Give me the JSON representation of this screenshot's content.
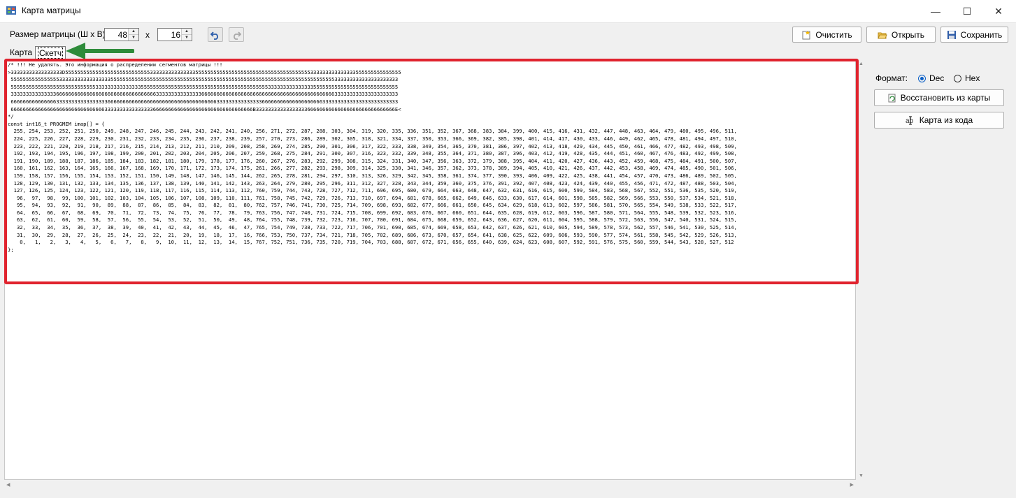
{
  "window": {
    "title": "Карта матрицы",
    "minimize": "—",
    "maximize": "☐",
    "close": "✕"
  },
  "toolbar": {
    "size_label": "Размер матрицы (Ш x В)",
    "width_value": "48",
    "height_value": "16",
    "x_label": "x",
    "undo_icon": "undo-icon",
    "redo_icon": "redo-icon",
    "clear_label": "Очистить",
    "open_label": "Открыть",
    "save_label": "Сохранить"
  },
  "tabs": [
    {
      "label": "Карта",
      "active": false
    },
    {
      "label": "Скетч",
      "active": true
    }
  ],
  "editor": {
    "lines": [
      "/* !!! Не удалять. Это информация о распределении сегментов матрицы !!!",
      ">33333333333333333D555555555555555555555555555533333333333333355555555555555555555555555555555555555333333333333333555555555555555",
      " 55555555555555553333333333333333355555555555555555555555555555555555555555555555555555555555555555555555555333333333333333333333",
      " 55555555555555555555555555553333333333333335555555555555555555555555555555555555555553333333333333335555555555555555555555555555",
      " 33333333333333366666666666666666666666666666666633333333333333366666666666666666666666666666666666666666666333333333333333333333",
      " 66666666666666633333333333333333666666666666666666666666666666666666333333333333333666666666666666666663333333333333333333333333",
      " 66666666666666666666666666666663333333333333333666666666666666666666666666666666B3333333333333333366666666666666666666666666666E<",
      "*/",
      "const int16_t PROGMEM imap[] = {",
      "  255, 254, 253, 252, 251, 250, 249, 248, 247, 246, 245, 244, 243, 242, 241, 240, 256, 271, 272, 287, 288, 303, 304, 319, 320, 335, 336, 351, 352, 367, 368, 383, 384, 399, 400, 415, 416, 431, 432, 447, 448, 463, 464, 479, 480, 495, 496, 511,",
      "  224, 225, 226, 227, 228, 229, 230, 231, 232, 233, 234, 235, 236, 237, 238, 239, 257, 270, 273, 286, 289, 302, 305, 318, 321, 334, 337, 350, 353, 366, 369, 382, 385, 398, 401, 414, 417, 430, 433, 446, 449, 462, 465, 478, 481, 494, 497, 510,",
      "  223, 222, 221, 220, 219, 218, 217, 216, 215, 214, 213, 212, 211, 210, 209, 208, 258, 269, 274, 285, 290, 301, 306, 317, 322, 333, 338, 349, 354, 365, 370, 381, 386, 397, 402, 413, 418, 429, 434, 445, 450, 461, 466, 477, 482, 493, 498, 509,",
      "  192, 193, 194, 195, 196, 197, 198, 199, 200, 201, 202, 203, 204, 205, 206, 207, 259, 268, 275, 284, 291, 300, 307, 316, 323, 332, 339, 348, 355, 364, 371, 380, 387, 396, 403, 412, 419, 428, 435, 444, 451, 460, 467, 476, 483, 492, 499, 508,",
      "  191, 190, 189, 188, 187, 186, 185, 184, 183, 182, 181, 180, 179, 178, 177, 176, 260, 267, 276, 283, 292, 299, 308, 315, 324, 331, 340, 347, 356, 363, 372, 379, 388, 395, 404, 411, 420, 427, 436, 443, 452, 459, 468, 475, 484, 491, 500, 507,",
      "  160, 161, 162, 163, 164, 165, 166, 167, 168, 169, 170, 171, 172, 173, 174, 175, 261, 266, 277, 282, 293, 298, 309, 314, 325, 330, 341, 346, 357, 362, 373, 378, 389, 394, 405, 410, 421, 426, 437, 442, 453, 458, 469, 474, 485, 490, 501, 506,",
      "  159, 158, 157, 156, 155, 154, 153, 152, 151, 150, 149, 148, 147, 146, 145, 144, 262, 265, 278, 281, 294, 297, 310, 313, 326, 329, 342, 345, 358, 361, 374, 377, 390, 393, 406, 409, 422, 425, 438, 441, 454, 457, 470, 473, 486, 489, 502, 505,",
      "  128, 129, 130, 131, 132, 133, 134, 135, 136, 137, 138, 139, 140, 141, 142, 143, 263, 264, 279, 280, 295, 296, 311, 312, 327, 328, 343, 344, 359, 360, 375, 376, 391, 392, 407, 408, 423, 424, 439, 440, 455, 456, 471, 472, 487, 488, 503, 504,",
      "  127, 126, 125, 124, 123, 122, 121, 120, 119, 118, 117, 116, 115, 114, 113, 112, 760, 759, 744, 743, 728, 727, 712, 711, 696, 695, 680, 679, 664, 663, 648, 647, 632, 631, 616, 615, 600, 599, 584, 583, 568, 567, 552, 551, 536, 535, 520, 519,",
      "   96,  97,  98,  99, 100, 101, 102, 103, 104, 105, 106, 107, 108, 109, 110, 111, 761, 758, 745, 742, 729, 726, 713, 710, 697, 694, 681, 678, 665, 662, 649, 646, 633, 630, 617, 614, 601, 598, 585, 582, 569, 566, 553, 550, 537, 534, 521, 518,",
      "   95,  94,  93,  92,  91,  90,  89,  88,  87,  86,  85,  84,  83,  82,  81,  80, 762, 757, 746, 741, 730, 725, 714, 709, 698, 693, 682, 677, 666, 661, 650, 645, 634, 629, 618, 613, 602, 597, 586, 581, 570, 565, 554, 549, 538, 533, 522, 517,",
      "   64,  65,  66,  67,  68,  69,  70,  71,  72,  73,  74,  75,  76,  77,  78,  79, 763, 756, 747, 740, 731, 724, 715, 708, 699, 692, 683, 676, 667, 660, 651, 644, 635, 628, 619, 612, 603, 596, 587, 580, 571, 564, 555, 548, 539, 532, 523, 516,",
      "   63,  62,  61,  60,  59,  58,  57,  56,  55,  54,  53,  52,  51,  50,  49,  48, 764, 755, 748, 739, 732, 723, 716, 707, 700, 691, 684, 675, 668, 659, 652, 643, 636, 627, 620, 611, 604, 595, 588, 579, 572, 563, 556, 547, 540, 531, 524, 515,",
      "   32,  33,  34,  35,  36,  37,  38,  39,  40,  41,  42,  43,  44,  45,  46,  47, 765, 754, 749, 738, 733, 722, 717, 706, 701, 690, 685, 674, 669, 658, 653, 642, 637, 626, 621, 610, 605, 594, 589, 578, 573, 562, 557, 546, 541, 530, 525, 514,",
      "   31,  30,  29,  28,  27,  26,  25,  24,  23,  22,  21,  20,  19,  18,  17,  16, 766, 753, 750, 737, 734, 721, 718, 705, 702, 689, 686, 673, 670, 657, 654, 641, 638, 625, 622, 609, 606, 593, 590, 577, 574, 561, 558, 545, 542, 529, 526, 513,",
      "    0,   1,   2,   3,   4,   5,   6,   7,   8,   9,  10,  11,  12,  13,  14,  15, 767, 752, 751, 736, 735, 720, 719, 704, 703, 688, 687, 672, 671, 656, 655, 640, 639, 624, 623, 608, 607, 592, 591, 576, 575, 560, 559, 544, 543, 528, 527, 512",
      "};"
    ]
  },
  "right_panel": {
    "format_label": "Формат:",
    "options": [
      {
        "label": "Dec",
        "selected": true
      },
      {
        "label": "Hex",
        "selected": false
      }
    ],
    "restore_label": "Восстановить из карты",
    "from_code_label": "Карта из кода"
  },
  "colors": {
    "highlight_border": "#e0232e",
    "arrow": "#2e8b3a",
    "radio_accent": "#0a5fc7"
  }
}
